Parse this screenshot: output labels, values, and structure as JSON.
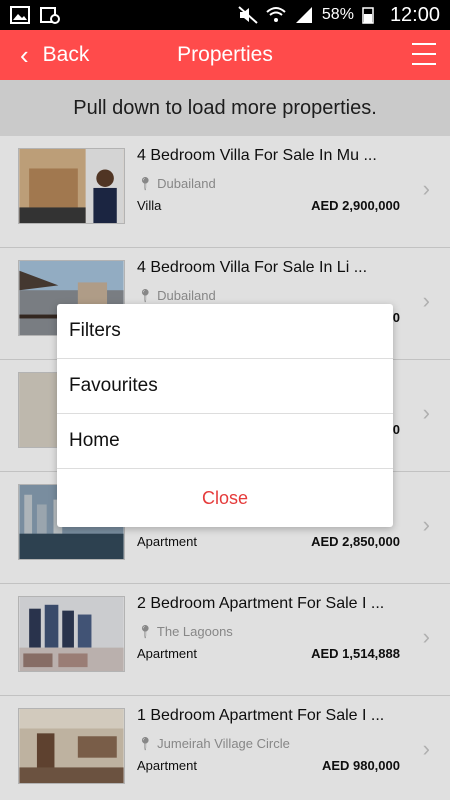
{
  "status_bar": {
    "battery": "58%",
    "time": "12:00"
  },
  "header": {
    "back_label": "Back",
    "title": "Properties"
  },
  "pull_text": "Pull down to load more properties.",
  "listings": [
    {
      "title": "4 Bedroom Villa For Sale In Mu ...",
      "location": "Dubailand",
      "type": "Villa",
      "price": "AED 2,900,000"
    },
    {
      "title": "4 Bedroom Villa For Sale In Li ...",
      "location": "Dubailand",
      "type": "",
      "price": "0"
    },
    {
      "title": "",
      "location": "",
      "type": "",
      "price": "0"
    },
    {
      "title": "",
      "location": "",
      "type": "Apartment",
      "price": "AED 2,850,000"
    },
    {
      "title": "2 Bedroom Apartment For Sale I ...",
      "location": "The Lagoons",
      "type": "Apartment",
      "price": "AED 1,514,888"
    },
    {
      "title": "1 Bedroom Apartment For Sale I ...",
      "location": "Jumeirah Village Circle",
      "type": "Apartment",
      "price": "AED 980,000"
    }
  ],
  "menu": {
    "items": [
      "Filters",
      "Favourites",
      "Home"
    ],
    "close_label": "Close"
  },
  "colors": {
    "brand": "#ff4b4b",
    "close_text": "#e53b3b"
  }
}
